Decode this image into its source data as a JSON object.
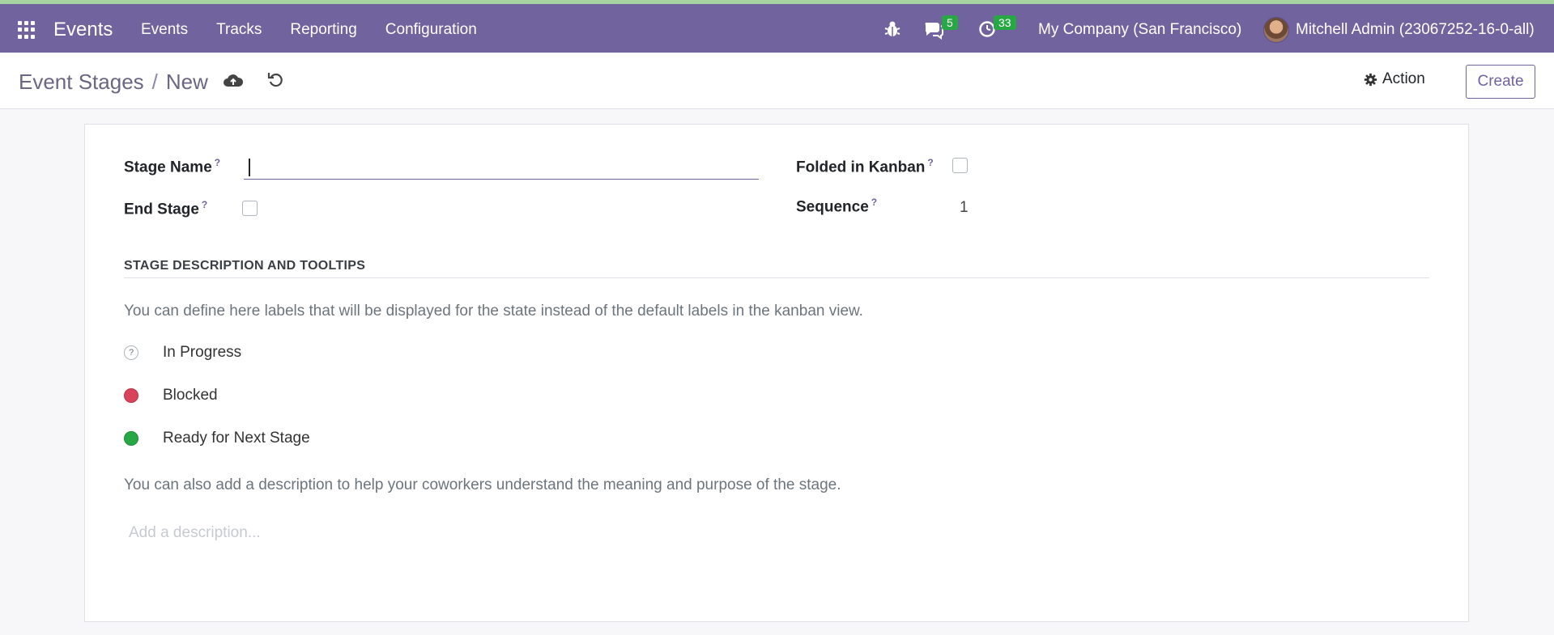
{
  "navbar": {
    "brand": "Events",
    "menu": [
      "Events",
      "Tracks",
      "Reporting",
      "Configuration"
    ],
    "chat_badge": "5",
    "activity_badge": "33",
    "company": "My Company (San Francisco)",
    "user": "Mitchell Admin (23067252-16-0-all)"
  },
  "breadcrumb": {
    "parent": "Event Stages",
    "separator": "/",
    "current": "New"
  },
  "actions": {
    "action_label": "Action",
    "create_label": "Create"
  },
  "form": {
    "stage_name_label": "Stage Name",
    "stage_name_value": "",
    "end_stage_label": "End Stage",
    "folded_label": "Folded in Kanban",
    "sequence_label": "Sequence",
    "sequence_value": "1",
    "help_mark": "?",
    "section_title": "STAGE DESCRIPTION AND TOOLTIPS",
    "section_text": "You can define here labels that will be displayed for the state instead of the default labels in the kanban view.",
    "states": [
      {
        "label": "In Progress",
        "color": "#ffffff"
      },
      {
        "label": "Blocked",
        "color": "#d9435c"
      },
      {
        "label": "Ready for Next Stage",
        "color": "#28a745"
      }
    ],
    "description_text": "You can also add a description to help your coworkers understand the meaning and purpose of the stage.",
    "description_placeholder": "Add a description..."
  },
  "colors": {
    "brand_purple": "#71639e",
    "badge_green": "#28a745"
  },
  "icons": [
    "apps-grid-icon",
    "bug-icon",
    "chat-icon",
    "clock-icon",
    "cloud-upload-icon",
    "discard-icon",
    "gear-icon",
    "help-icon"
  ]
}
